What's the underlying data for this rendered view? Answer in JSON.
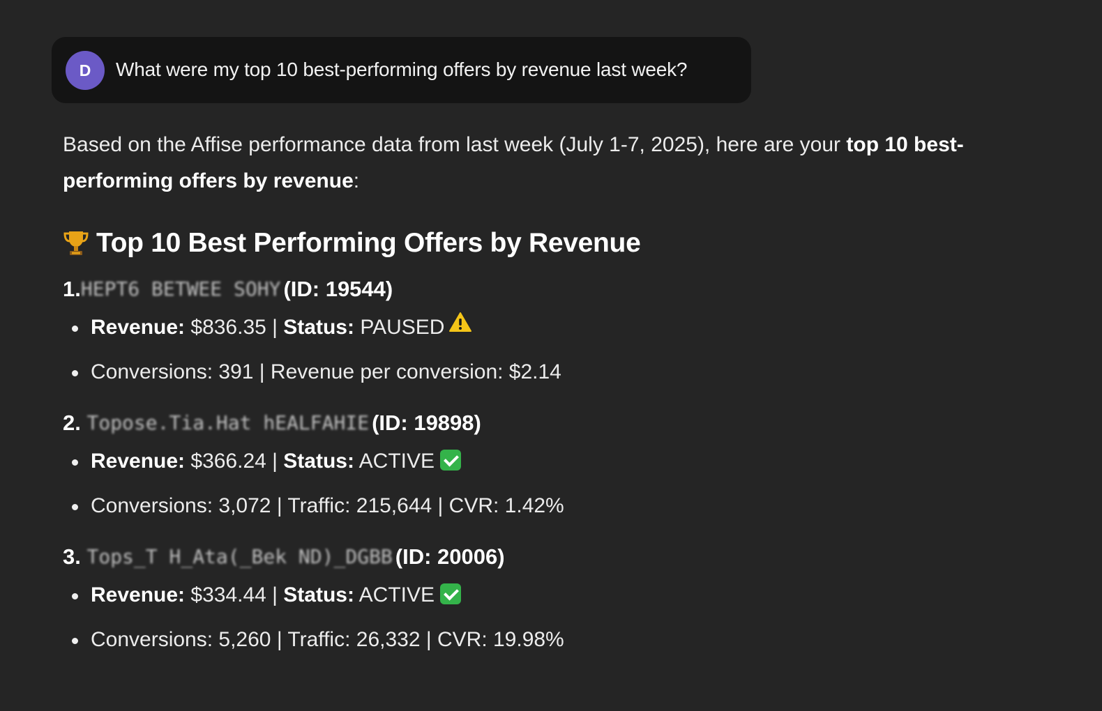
{
  "user_message": {
    "avatar_initial": "D",
    "text": "What were my top 10 best-performing offers by revenue last week?"
  },
  "answer": {
    "intro_plain": "Based on the Affise performance data from last week (July 1-7, 2025), here are your ",
    "intro_bold": "top 10 best-performing offers by revenue",
    "intro_end": ":",
    "heading": "Top 10 Best Performing Offers by Revenue",
    "heading_icon": "trophy-icon",
    "offers": [
      {
        "number": "1.",
        "name_redacted": "HEPT6 BETWEE SOHY",
        "id_text": "(ID: 19544)",
        "revenue_label": "Revenue:",
        "revenue_value": " $836.35 | ",
        "status_label": "Status:",
        "status_value": " PAUSED",
        "status_icon": "warning-icon",
        "detail": "Conversions: 391 | Revenue per conversion: $2.14"
      },
      {
        "number": "2.",
        "name_redacted": "Topose.Tia.Hat hEALFAHIE",
        "id_text": "(ID: 19898)",
        "revenue_label": "Revenue:",
        "revenue_value": " $366.24 | ",
        "status_label": "Status:",
        "status_value": " ACTIVE",
        "status_icon": "check-icon",
        "detail": "Conversions: 3,072 | Traffic: 215,644 | CVR: 1.42%"
      },
      {
        "number": "3.",
        "name_redacted": "Tops_T H_Ata(_Bek ND)_DGBB",
        "id_text": "(ID: 20006)",
        "revenue_label": "Revenue:",
        "revenue_value": " $334.44 | ",
        "status_label": "Status:",
        "status_value": " ACTIVE",
        "status_icon": "check-icon",
        "detail": "Conversions: 5,260 | Traffic: 26,332 | CVR: 19.98%"
      }
    ]
  },
  "colors": {
    "background": "#252525",
    "user_bubble": "#141414",
    "avatar": "#6b5ac6",
    "check_green": "#34b34a",
    "warning_yellow": "#f5c518"
  }
}
